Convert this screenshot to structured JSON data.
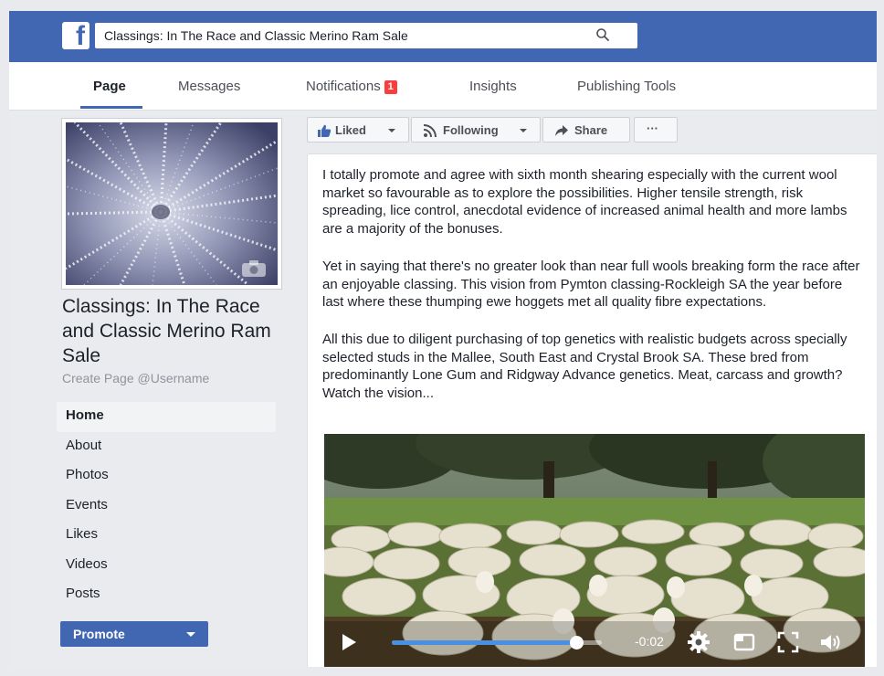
{
  "header": {
    "search_value": "Classings: In The Race and Classic Merino Ram Sale",
    "logo_letter": "f"
  },
  "nav": {
    "tabs": [
      {
        "label": "Page",
        "active": true
      },
      {
        "label": "Messages"
      },
      {
        "label": "Notifications",
        "badge": "1"
      },
      {
        "label": "Insights"
      },
      {
        "label": "Publishing Tools"
      }
    ]
  },
  "page": {
    "name": "Classings: In The Race and Classic Merino Ram Sale",
    "create_username": "Create Page @Username"
  },
  "sidebar": {
    "items": [
      {
        "label": "Home",
        "active": true
      },
      {
        "label": "About"
      },
      {
        "label": "Photos"
      },
      {
        "label": "Events"
      },
      {
        "label": "Likes"
      },
      {
        "label": "Videos"
      },
      {
        "label": "Posts"
      }
    ],
    "promote_label": "Promote"
  },
  "actions": {
    "liked": "Liked",
    "following": "Following",
    "share": "Share",
    "more": "···"
  },
  "post": {
    "paragraphs": [
      "I totally promote and agree with sixth month shearing especially with the current wool market so favourable as to explore the possibilities. Higher tensile strength, risk spreading, lice control, anecdotal evidence of increased animal health and more lambs are a majority of the bonuses.",
      "Yet in saying that there's no greater look than near full wools breaking form the race after an enjoyable classing. This vision from Pymton classing-Rockleigh SA the year before last where these thumping ewe hoggets met all quality fibre expectations.",
      "All this due to diligent purchasing of top genetics with realistic budgets across specially selected studs in the Mallee, South East and Crystal Brook SA. These bred from predominantly Lone Gum and Ridgway Advance genetics. Meat, carcass and growth? Watch the vision..."
    ]
  },
  "video": {
    "time_remaining": "-0:02",
    "progress_fraction": 0.88
  },
  "colors": {
    "brand": "#4267b2",
    "badge": "#fa3e3e",
    "progress": "#4a90e2"
  }
}
